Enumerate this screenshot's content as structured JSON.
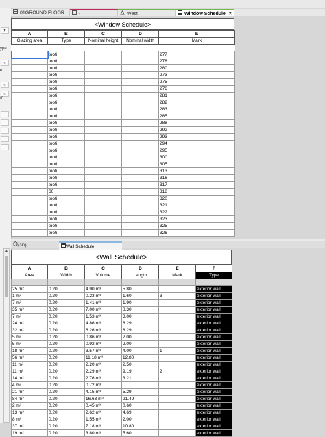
{
  "tabs": [
    {
      "label": "01GROUND FLOOR",
      "icon": "floor-plan-icon",
      "active": false
    },
    {
      "label": "-",
      "icon": "sheet-icon",
      "active": false
    },
    {
      "label": "West",
      "icon": "elevation-icon",
      "active": false
    },
    {
      "label": "Window Schedule",
      "icon": "schedule-icon",
      "active": true
    }
  ],
  "left_strip": {
    "labels": [
      "ype",
      "e",
      "ın"
    ]
  },
  "window_schedule": {
    "title": "<Window Schedule>",
    "letters": [
      "A",
      "B",
      "C",
      "D",
      "E"
    ],
    "headers": [
      "Glazing area",
      "Type",
      "Nominal height",
      "Nominal width",
      "Mark"
    ],
    "rows": [
      [
        "",
        "tooti",
        "",
        "",
        "277"
      ],
      [
        "",
        "tooti",
        "",
        "",
        "278"
      ],
      [
        "",
        "tooti",
        "",
        "",
        "280"
      ],
      [
        "",
        "tooti",
        "",
        "",
        "273"
      ],
      [
        "",
        "tooti",
        "",
        "",
        "275"
      ],
      [
        "",
        "tooti",
        "",
        "",
        "276"
      ],
      [
        "",
        "tooti",
        "",
        "",
        "281"
      ],
      [
        "",
        "tooti",
        "",
        "",
        "282"
      ],
      [
        "",
        "tooti",
        "",
        "",
        "283"
      ],
      [
        "",
        "tooti",
        "",
        "",
        "285"
      ],
      [
        "",
        "tooti",
        "",
        "",
        "288"
      ],
      [
        "",
        "tooti",
        "",
        "",
        "292"
      ],
      [
        "",
        "tooti",
        "",
        "",
        "293"
      ],
      [
        "",
        "tooti",
        "",
        "",
        "294"
      ],
      [
        "",
        "tooti",
        "",
        "",
        "295"
      ],
      [
        "",
        "tooti",
        "",
        "",
        "300"
      ],
      [
        "",
        "tooti",
        "",
        "",
        "305"
      ],
      [
        "",
        "tooti",
        "",
        "",
        "313"
      ],
      [
        "",
        "tooti",
        "",
        "",
        "316"
      ],
      [
        "",
        "tooti",
        "",
        "",
        "317"
      ],
      [
        "",
        "60",
        "",
        "",
        "318"
      ],
      [
        "",
        "tooti",
        "",
        "",
        "320"
      ],
      [
        "",
        "tooti",
        "",
        "",
        "321"
      ],
      [
        "",
        "tooti",
        "",
        "",
        "322"
      ],
      [
        "",
        "tooti",
        "",
        "",
        "323"
      ],
      [
        "",
        "tooti",
        "",
        "",
        "325"
      ],
      [
        "",
        "tooti",
        "",
        "",
        "326"
      ]
    ]
  },
  "tabs2": [
    {
      "label": "{3D}",
      "icon": "3d-view-icon",
      "active": false
    },
    {
      "label": "Wall Schedule",
      "icon": "schedule-icon",
      "active": true
    }
  ],
  "wall_schedule": {
    "title": "<Wall Schedule>",
    "letters": [
      "A",
      "B",
      "C",
      "D",
      "E",
      "F"
    ],
    "headers": [
      "Area",
      "Width",
      "Volume",
      "Length",
      "Mark",
      "Type"
    ],
    "rows": [
      [
        "25 m²",
        "0.20",
        "4.90 m³",
        "5.80",
        "",
        "exterior wall"
      ],
      [
        "1 m²",
        "0.20",
        "0.23 m³",
        "1.60",
        "3",
        "exterior wall"
      ],
      [
        "7 m²",
        "0.20",
        "1.41 m³",
        "1.90",
        "",
        "exterior wall"
      ],
      [
        "35 m²",
        "0.20",
        "7.00 m³",
        "8.30",
        "",
        "exterior wall"
      ],
      [
        "7 m²",
        "0.20",
        "1.53 m³",
        "3.00",
        "",
        "exterior wall"
      ],
      [
        "24 m²",
        "0.20",
        "4.86 m³",
        "8.29",
        "",
        "exterior wall"
      ],
      [
        "32 m²",
        "0.20",
        "6.26 m³",
        "8.29",
        "",
        "exterior wall"
      ],
      [
        "5 m²",
        "0.20",
        "0.86 m³",
        "2.00",
        "",
        "exterior wall"
      ],
      [
        "5 m²",
        "0.20",
        "0.92 m³",
        "2.00",
        "",
        "exterior wall"
      ],
      [
        "18 m²",
        "0.20",
        "3.57 m³",
        "4.00",
        "1",
        "exterior wall"
      ],
      [
        "56 m²",
        "0.20",
        "11.18 m³",
        "12.80",
        "",
        "exterior wall"
      ],
      [
        "11 m²",
        "0.20",
        "2.20 m³",
        "2.50",
        "",
        "exterior wall"
      ],
      [
        "11 m²",
        "0.20",
        "2.29 m³",
        "9.19",
        "2",
        "exterior wall"
      ],
      [
        "14 m²",
        "0.20",
        "2.76 m³",
        "3.21",
        "",
        "exterior wall"
      ],
      [
        "4 m²",
        "0.20",
        "0.72 m³",
        "",
        "",
        "exterior wall"
      ],
      [
        "21 m²",
        "0.20",
        "4.15 m³",
        "5.29",
        "",
        "exterior wall"
      ],
      [
        "84 m²",
        "0.20",
        "16.63 m³",
        "21.49",
        "",
        "exterior wall"
      ],
      [
        "2 m²",
        "0.20",
        "0.45 m³",
        "0.60",
        "",
        "exterior wall"
      ],
      [
        "13 m²",
        "0.20",
        "2.62 m³",
        "4.69",
        "",
        "exterior wall"
      ],
      [
        "8 m²",
        "0.20",
        "1.55 m³",
        "2.00",
        "",
        "exterior wall"
      ],
      [
        "37 m²",
        "0.20",
        "7.18 m³",
        "10.80",
        "",
        "exterior wall"
      ],
      [
        "19 m²",
        "0.20",
        "3.80 m³",
        "5.60",
        "",
        "exterior wall"
      ]
    ]
  }
}
